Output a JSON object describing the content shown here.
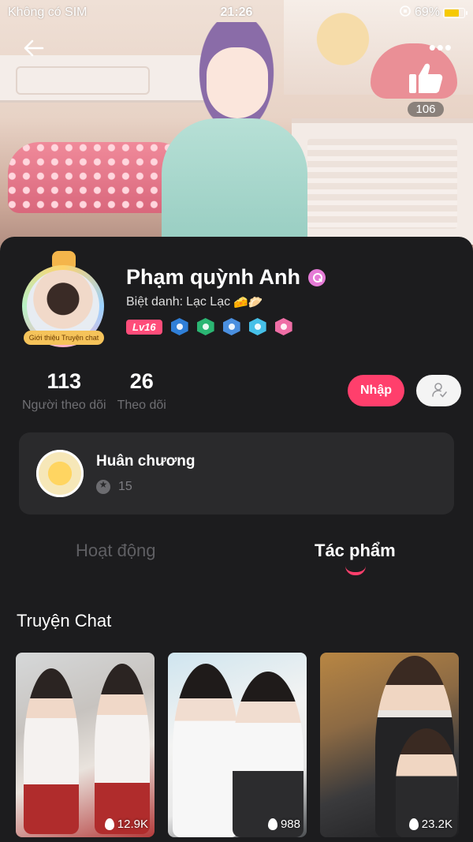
{
  "status_bar": {
    "carrier": "Không có SIM",
    "time": "21:26",
    "battery": "69%",
    "battery_level": 0.69
  },
  "header": {
    "like_count": "106"
  },
  "profile": {
    "name": "Phạm quỳnh Anh",
    "nickname_label": "Biệt danh:",
    "nickname_value": "Lạc Lạc",
    "nickname_emoji": "🧀🥟",
    "level": "Lv16",
    "avatar_tag": "Giới thiệu Truyện chat",
    "badge_colors": [
      "#2f7fd8",
      "#2bb673",
      "#4a8fe0",
      "#46c0e8",
      "#ef6ea6"
    ]
  },
  "stats": {
    "followers_count": "113",
    "followers_label": "Người theo dõi",
    "following_count": "26",
    "following_label": "Theo dõi"
  },
  "actions": {
    "enter_label": "Nhập"
  },
  "medals": {
    "title": "Huân chương",
    "count": "15"
  },
  "tabs": {
    "activity": "Hoạt động",
    "works": "Tác phẩm",
    "active": "works"
  },
  "section": {
    "title": "Truyện Chat"
  },
  "stories": [
    {
      "count": "12.9K"
    },
    {
      "count": "988"
    },
    {
      "count": "23.2K"
    }
  ],
  "colors": {
    "accent": "#ff3f6c",
    "background": "#1c1c1e",
    "card": "#2a2a2c"
  }
}
